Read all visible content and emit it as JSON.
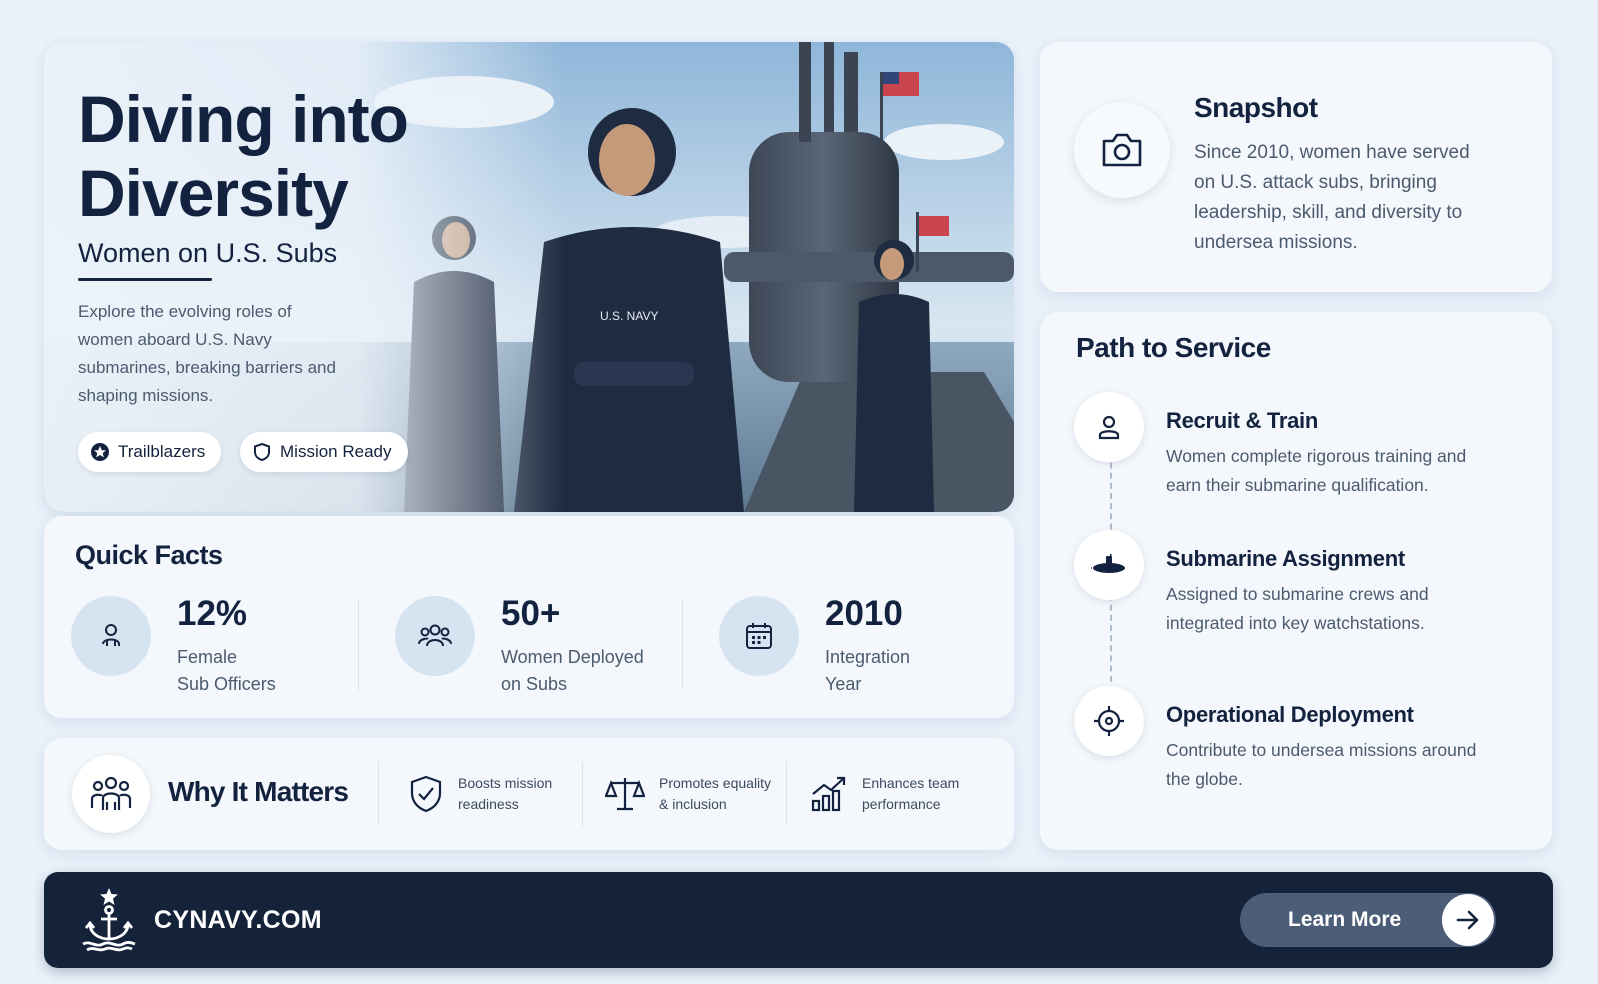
{
  "hero": {
    "title_line1": "Diving into",
    "title_line2": "Diversity",
    "subtitle": "Women on U.S. Subs",
    "description": "Explore the evolving roles of women aboard U.S. Navy submarines, breaking barriers and shaping missions.",
    "pills": [
      {
        "label": "Trailblazers",
        "icon": "star-badge-icon"
      },
      {
        "label": "Mission Ready",
        "icon": "shield-icon"
      }
    ],
    "photo_text": {
      "patch": "U.S. NAVY"
    }
  },
  "quick_facts": {
    "title": "Quick Facts",
    "items": [
      {
        "value": "12%",
        "label_line1": "Female",
        "label_line2": "Sub Officers",
        "icon": "person-icon"
      },
      {
        "value": "50+",
        "label_line1": "Women Deployed",
        "label_line2": "on Subs",
        "icon": "group-icon"
      },
      {
        "value": "2010",
        "label_line1": "Integration",
        "label_line2": "Year",
        "icon": "calendar-icon"
      }
    ]
  },
  "why": {
    "title": "Why It Matters",
    "items": [
      {
        "line1": "Boosts mission",
        "line2": "readiness",
        "icon": "shield-check-icon"
      },
      {
        "line1": "Promotes equality",
        "line2": "& inclusion",
        "icon": "scales-icon"
      },
      {
        "line1": "Enhances team",
        "line2": "performance",
        "icon": "growth-chart-icon"
      }
    ]
  },
  "snapshot": {
    "title": "Snapshot",
    "text": "Since 2010, women have served on U.S. attack subs, bringing leadership, skill, and diversity to undersea missions.",
    "icon": "camera-icon"
  },
  "path": {
    "title": "Path to Service",
    "steps": [
      {
        "title": "Recruit & Train",
        "text": "Women complete rigorous training and earn their submarine qualification.",
        "icon": "person-icon"
      },
      {
        "title": "Submarine Assignment",
        "text": "Assigned to submarine crews and integrated into key watchstations.",
        "icon": "submarine-icon"
      },
      {
        "title": "Operational Deployment",
        "text": "Contribute to undersea missions around the globe.",
        "icon": "crosshair-icon"
      }
    ]
  },
  "footer": {
    "brand": "CYNAVY.COM",
    "cta": "Learn More",
    "logo_icon": "anchor-icon",
    "cta_icon": "arrow-right-icon"
  },
  "colors": {
    "navy": "#13233f",
    "footer_bg": "#15233a",
    "button_bg": "#4b5d77",
    "page_bg": "#e9f1fa",
    "icon_circle": "#d6e4f1"
  }
}
